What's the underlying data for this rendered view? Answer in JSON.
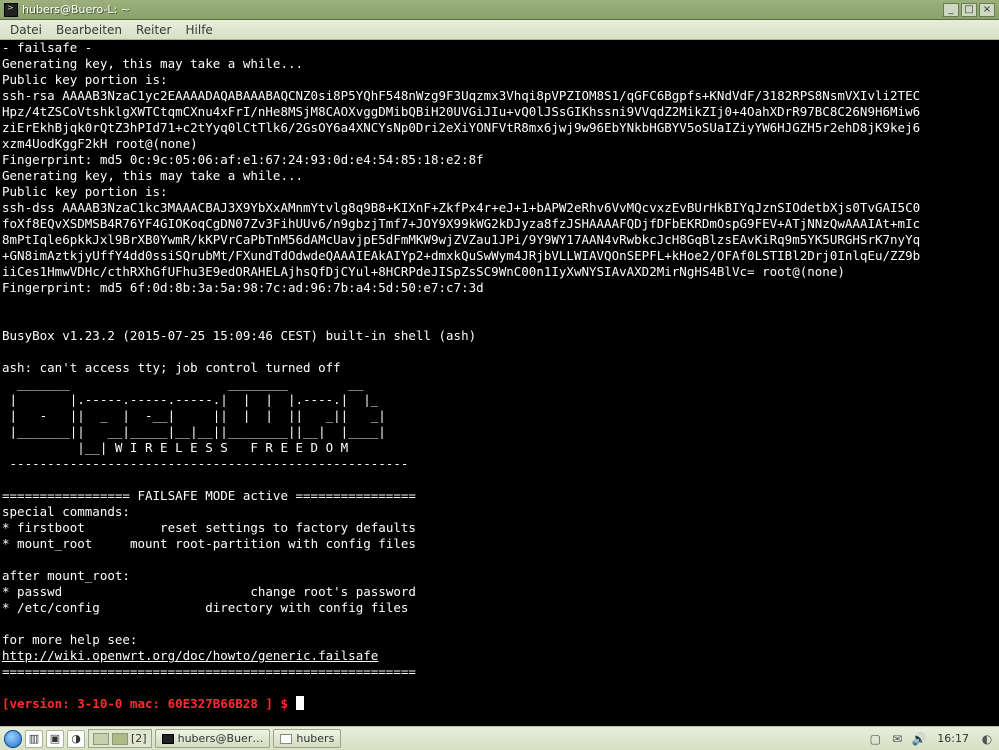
{
  "window": {
    "title": "hubers@Buero-L: ~"
  },
  "menu": {
    "datei": "Datei",
    "bearbeiten": "Bearbeiten",
    "reiter": "Reiter",
    "hilfe": "Hilfe"
  },
  "terminal": {
    "lines": {
      "l0": "- failsafe -",
      "l1": "Generating key, this may take a while...",
      "l2": "Public key portion is:",
      "l3": "ssh-rsa AAAAB3NzaC1yc2EAAAADAQABAAABAQCNZ0si8P5YQhF548nWzg9F3Uqzmx3Vhqi8pVPZIOM8S1/qGFC6Bgpfs+KNdVdF/3182RPS8NsmVXIvli2TEC",
      "l4": "Hpz/4tZSCoVtshklgXWTCtqmCXnu4xFrI/nHe8MSjM8CAOXvggDMibQBiH20UVGiJIu+vQ0lJSsGIKhssni9VVqdZ2MikZIj0+4OahXDrR97BC8C26N9H6Miw6",
      "l5": "ziErEkhBjqk0rQtZ3hPId71+c2tYyq0lCtTlk6/2GsOY6a4XNCYsNp0Dri2eXiYONFVtR8mx6jwj9w96EbYNkbHGBYV5oSUaIZiyYW6HJGZH5r2ehD8jK9kej6",
      "l6": "xzm4UodKggF2kH root@(none)",
      "l7": "Fingerprint: md5 0c:9c:05:06:af:e1:67:24:93:0d:e4:54:85:18:e2:8f",
      "l8": "Generating key, this may take a while...",
      "l9": "Public key portion is:",
      "l10": "ssh-dss AAAAB3NzaC1kc3MAAACBAJ3X9YbXxAMnmYtvlg8q9B8+KIXnF+ZkfPx4r+eJ+1+bAPW2eRhv6VvMQcvxzEvBUrHkBIYqJznSIOdetbXjs0TvGAI5C0",
      "l11": "foXf8EQvXSDMSB4R76YF4GIOKoqCgDN07Zv3FihUUv6/n9gbzjTmf7+JOY9X99kWG2kDJyza8fzJSHAAAAFQDjfDFbEKRDmOspG9FEV+ATjNNzQwAAAIAt+mIc",
      "l12": "8mPtIqle6pkkJxl9BrXB0YwmR/kKPVrCaPbTnM56dAMcUavjpE5dFmMKW9wjZVZau1JPi/9Y9WY17AAN4vRwbkcJcH8GqBlzsEAvKiRq9m5YK5URGHSrK7nyYq",
      "l13": "+GN8imAztkjyUffY4dd0ssiSQrubMt/FXundTdOdwdeQAAAIEAkAIYp2+dmxkQuSwWym4JRjbVLLWIAVQOnSEPFL+kHoe2/OFAf0LSTIBl2Drj0InlqEu/ZZ9b",
      "l14": "iiCes1HmwVDHc/cthRXhGfUFhu3E9edORAHELAjhsQfDjCYul+8HCRPdeJISpZsSC9WnC00n1IyXwNYSIAvAXD2MirNgHS4BlVc= root@(none)",
      "l15": "Fingerprint: md5 6f:0d:8b:3a:5a:98:7c:ad:96:7b:a4:5d:50:e7:c7:3d",
      "blank1": "",
      "blank2": "",
      "l16": "BusyBox v1.23.2 (2015-07-25 15:09:46 CEST) built-in shell (ash)",
      "blank3": "",
      "l17": "ash: can't access tty; job control turned off",
      "art0": "  _______                     ________        __",
      "art1": " |       |.-----.-----.-----.|  |  |  |.----.|  |_",
      "art2": " |   -   ||  _  |  -__|     ||  |  |  ||   _||   _|",
      "art3": " |_______||   __|_____|__|__||________||__|  |____|",
      "art4": "          |__| W I R E L E S S   F R E E D O M",
      "art5": " -----------------------------------------------------",
      "blank4": "",
      "l18": "================= FAILSAFE MODE active ================",
      "l19": "special commands:",
      "l20": "* firstboot\t     reset settings to factory defaults",
      "l21": "* mount_root\t mount root-partition with config files",
      "blank5": "",
      "l22": "after mount_root:",
      "l23": "* passwd\t\t\t change root's password",
      "l24": "* /etc/config\t\t   directory with config files",
      "blank6": "",
      "l25": "for more help see:",
      "link": "http://wiki.openwrt.org/doc/howto/generic.failsafe",
      "l26": "=======================================================",
      "blank7": ""
    },
    "prompt": {
      "version": "[version: 3-10-0 mac: 60E327B66B28 ]",
      "dollar": " $ "
    }
  },
  "taskbar": {
    "pager_label": "[2]",
    "task1": "hubers@Buer…",
    "task2": "hubers",
    "clock": "16:17"
  }
}
